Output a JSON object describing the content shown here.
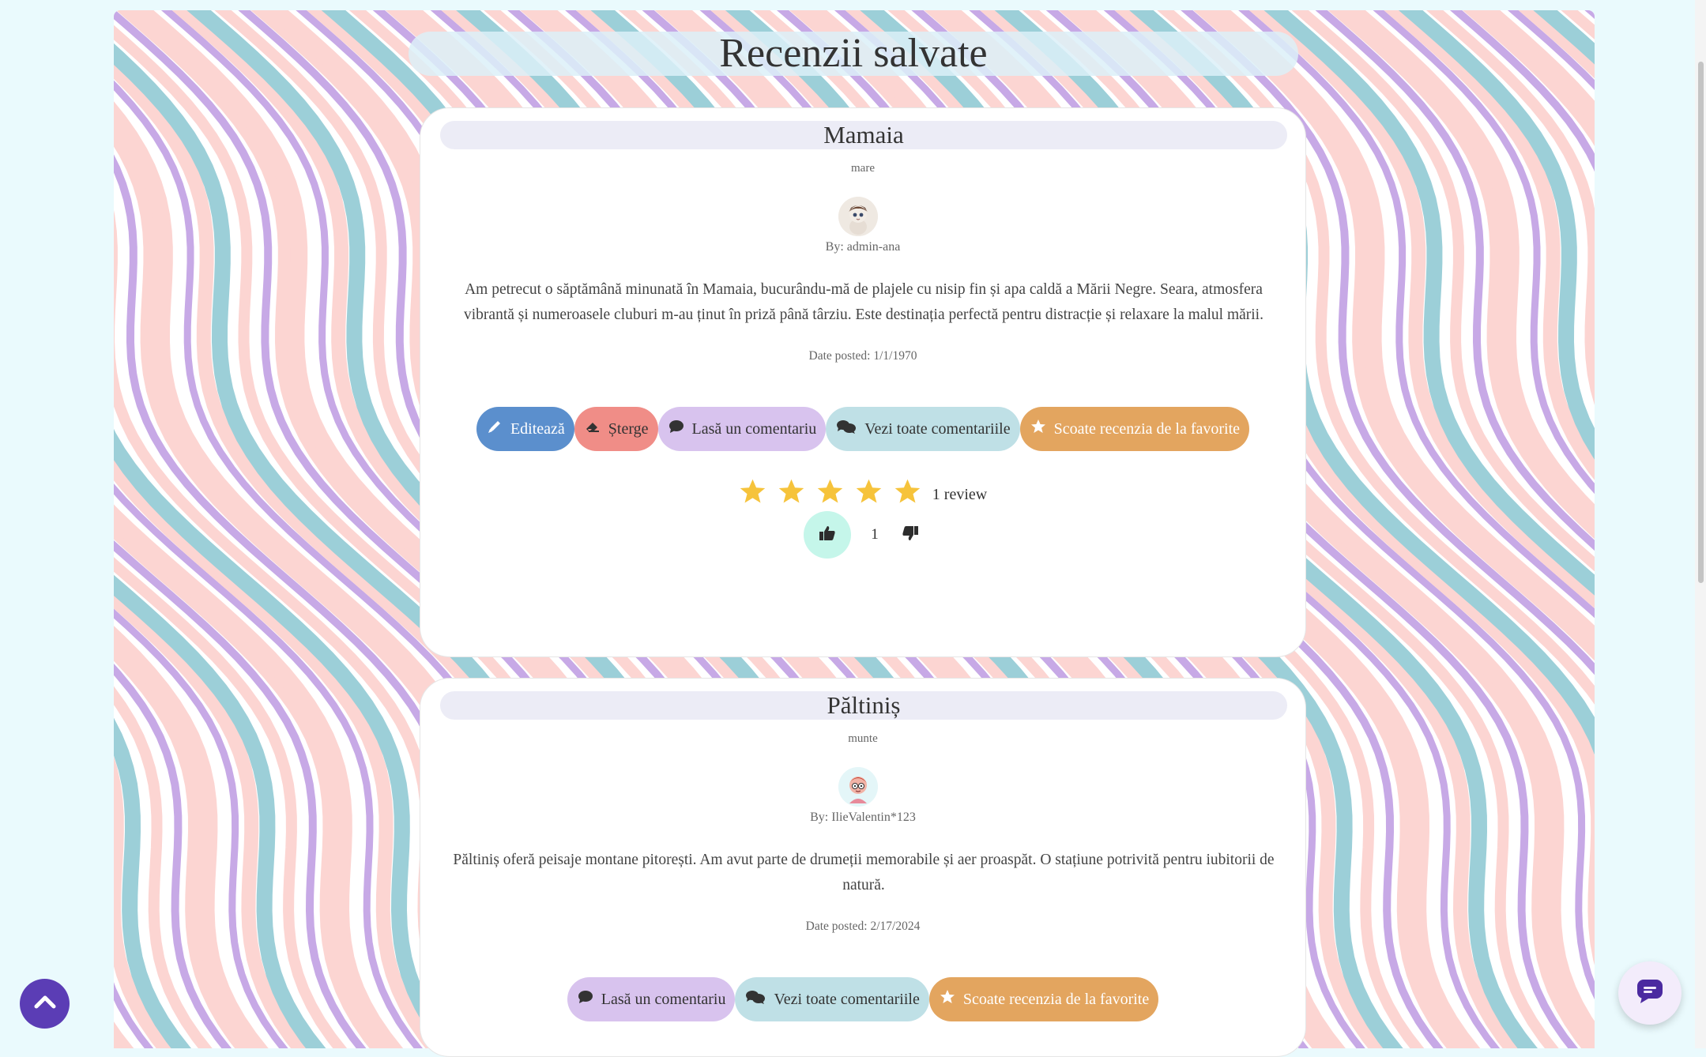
{
  "page": {
    "title": "Recenzii salvate"
  },
  "reviews": [
    {
      "title": "Mamaia",
      "category": "mare",
      "author": "By: admin-ana",
      "body": "Am petrecut o săptămână minunată în Mamaia, bucurându-mă de plajele cu nisip fin și apa caldă a Mării Negre. Seara, atmosfera vibrantă și numeroasele cluburi m-au ținut în priză până târziu. Este destinația perfectă pentru distracție și relaxare la malul mării.",
      "date": "Date posted: 1/1/1970",
      "actions": {
        "edit": "Editează",
        "delete": "Șterge",
        "comment": "Lasă un comentariu",
        "view_comments": "Vezi toate comentariile",
        "unfavorite": "Scoate recenzia de la favorite"
      },
      "rating": {
        "stars": 5,
        "max": 5,
        "label": "1 review"
      },
      "votes": "1"
    },
    {
      "title": "Păltiniș",
      "category": "munte",
      "author": "By: IlieValentin*123",
      "body": "Păltiniș oferă peisaje montane pitorești. Am avut parte de drumeții memorabile și aer proaspăt. O stațiune potrivită pentru iubitorii de natură.",
      "date": "Date posted: 2/17/2024",
      "actions": {
        "comment": "Lasă un comentariu",
        "view_comments": "Vezi toate comentariile",
        "unfavorite": "Scoate recenzia de la favorite"
      }
    }
  ],
  "icons": {
    "edit": "pen-icon",
    "delete": "eraser-icon",
    "comment": "comment-icon",
    "view_comments": "comments-icon",
    "unfavorite": "star-icon",
    "up": "thumbs-up-icon",
    "down": "thumbs-down-icon",
    "scroll_top": "chevron-up-icon",
    "chat": "chat-bubble-icon"
  },
  "colors": {
    "edit": "#5b8fcd",
    "delete": "#f08d87",
    "comment": "#d8c3ee",
    "view_comments": "#bfe0e6",
    "favorite": "#e3a55f",
    "star": "#f6c33b",
    "like_active": "#c5f6ea",
    "scroll_top": "#5b3db5"
  }
}
